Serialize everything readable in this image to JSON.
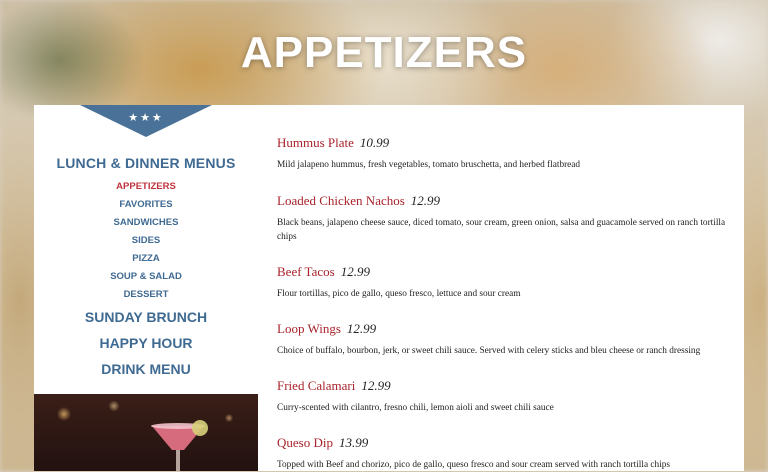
{
  "page_title": "APPETIZERS",
  "ribbon_stars": "★★★",
  "sidebar": {
    "heading": "LUNCH & DINNER MENUS",
    "sub_items": [
      {
        "label": "APPETIZERS",
        "active": true
      },
      {
        "label": "FAVORITES"
      },
      {
        "label": "SANDWICHES"
      },
      {
        "label": "SIDES"
      },
      {
        "label": "PIZZA"
      },
      {
        "label": "SOUP & SALAD"
      },
      {
        "label": "DESSERT"
      }
    ],
    "links": [
      "SUNDAY BRUNCH",
      "HAPPY HOUR",
      "DRINK MENU"
    ]
  },
  "menu_items": [
    {
      "name": "Hummus Plate",
      "price": "10.99",
      "description": "Mild jalapeno hummus, fresh vegetables, tomato bruschetta, and herbed flatbread"
    },
    {
      "name": "Loaded Chicken Nachos",
      "price": "12.99",
      "description": "Black beans, jalapeno cheese sauce, diced tomato, sour cream, green onion, salsa and guacamole served on ranch tortilla chips"
    },
    {
      "name": "Beef Tacos",
      "price": "12.99",
      "description": "Flour tortillas, pico de gallo, queso fresco, lettuce and sour cream"
    },
    {
      "name": "Loop Wings",
      "price": "12.99",
      "description": "Choice of buffalo, bourbon, jerk, or sweet chili sauce. Served with celery sticks and bleu cheese or ranch dressing"
    },
    {
      "name": "Fried Calamari",
      "price": "12.99",
      "description": "Curry-scented with cilantro, fresno chili, lemon aioli and sweet chili sauce"
    },
    {
      "name": "Queso Dip",
      "price": "13.99",
      "description": "Topped with Beef and chorizo, pico de gallo, queso fresco and sour cream served with ranch tortilla chips"
    }
  ],
  "colors": {
    "accent_red": "#c0333d",
    "nav_blue": "#3f6a92",
    "ribbon": "#4a7197"
  }
}
